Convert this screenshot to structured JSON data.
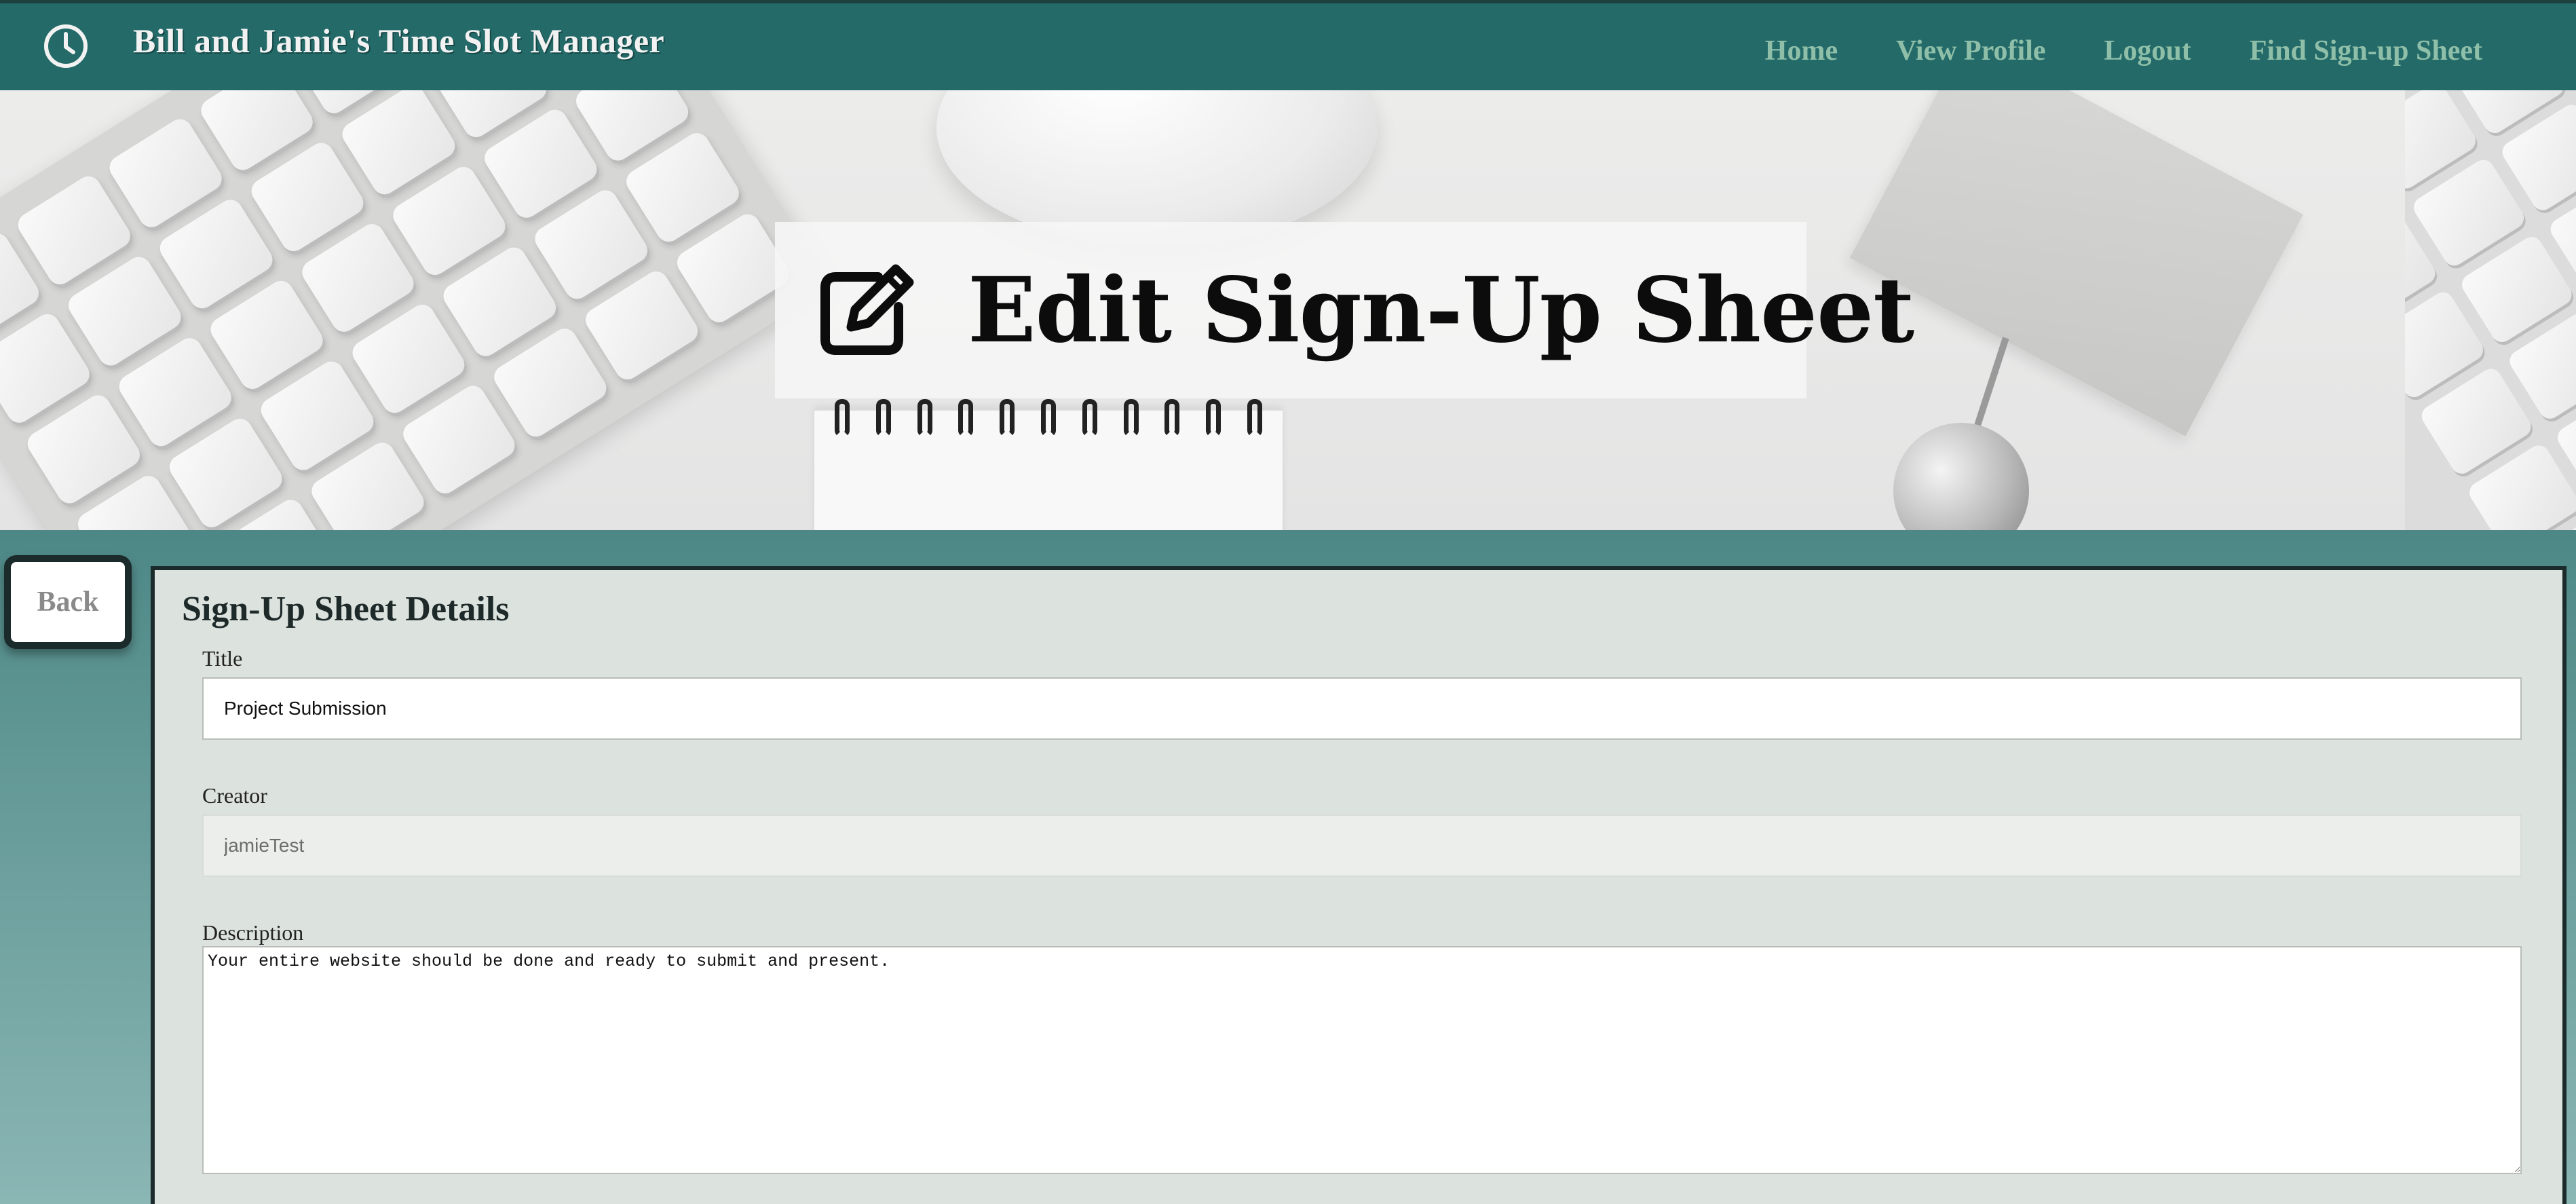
{
  "app": {
    "brand": "Bill and Jamie's Time Slot Manager",
    "logo_icon": "clock-icon"
  },
  "nav": {
    "items": [
      {
        "label": "Home"
      },
      {
        "label": "View Profile"
      },
      {
        "label": "Logout"
      },
      {
        "label": "Find Sign-up Sheet"
      }
    ]
  },
  "hero": {
    "title": "Edit Sign-Up Sheet",
    "icon": "edit-icon"
  },
  "back_button": {
    "label": "Back"
  },
  "form": {
    "heading": "Sign-Up Sheet Details",
    "title": {
      "label": "Title",
      "value": "Project Submission"
    },
    "creator": {
      "label": "Creator",
      "value": "jamieTest"
    },
    "description": {
      "label": "Description",
      "value": "Your entire website should be done and ready to submit and present."
    }
  },
  "colors": {
    "nav_bg": "#236a69",
    "nav_link": "#8fbfa8",
    "panel_bg": "#dce2dd",
    "page_teal": "#4d8886"
  }
}
